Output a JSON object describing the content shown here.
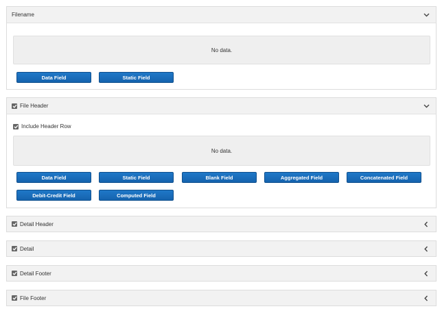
{
  "filename_panel": {
    "title": "Filename",
    "no_data": "No data.",
    "buttons": [
      "Data Field",
      "Static Field"
    ]
  },
  "file_header_panel": {
    "title": "File Header",
    "checked": true,
    "include_header_row": "Include Header Row",
    "no_data": "No data.",
    "buttons": [
      "Data Field",
      "Static Field",
      "Blank Field",
      "Aggregated Field",
      "Concatenated Field",
      "Debit-Credit Field",
      "Computed Field"
    ]
  },
  "collapsed_panels": [
    {
      "title": "Detail Header",
      "checked": true
    },
    {
      "title": "Detail",
      "checked": true
    },
    {
      "title": "Detail Footer",
      "checked": true
    },
    {
      "title": "File Footer",
      "checked": true
    }
  ],
  "icons": {
    "expanded": "chevron-down-icon",
    "collapsed": "chevron-left-icon",
    "checkbox": "checkbox-checked-icon"
  },
  "colors": {
    "button_bg": "#1a6dbb",
    "panel_header_bg": "#f2f2f2",
    "nodata_bg": "#efefef"
  }
}
